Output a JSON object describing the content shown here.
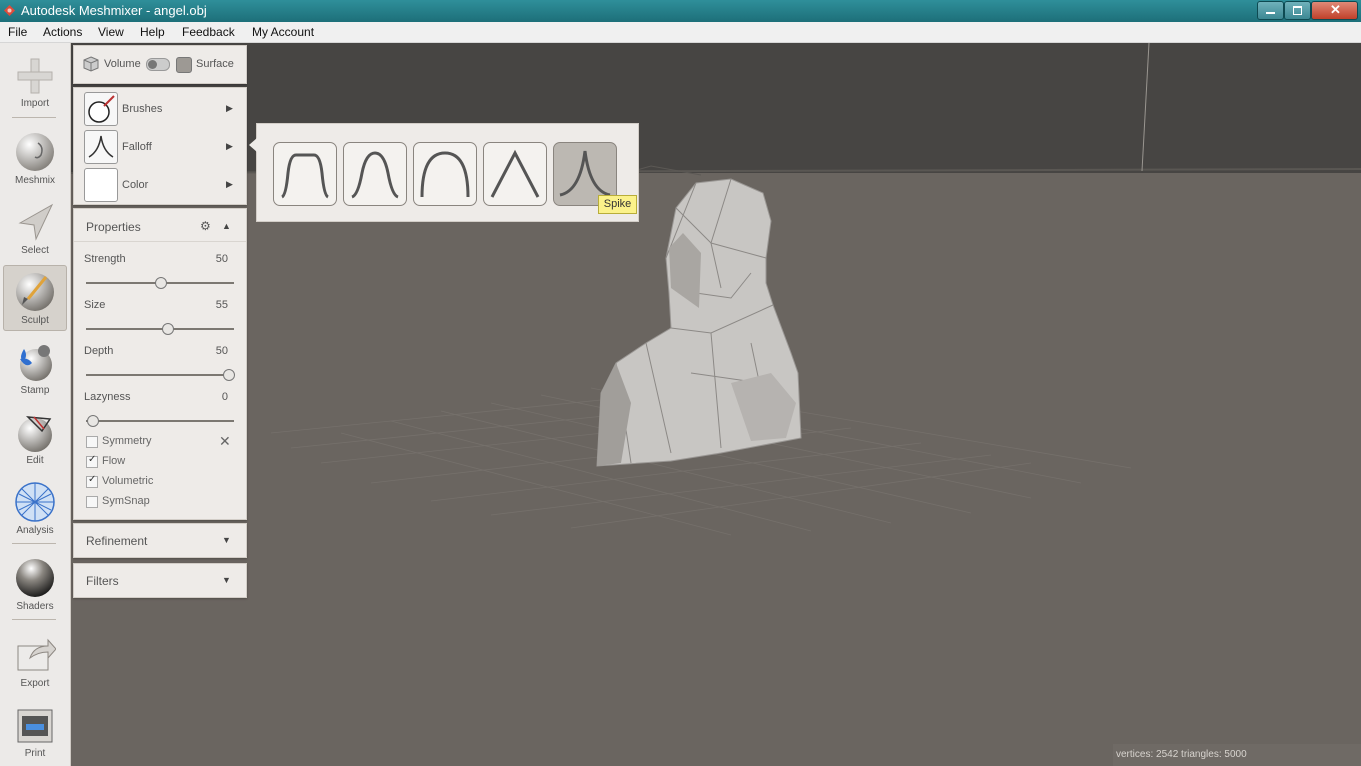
{
  "window": {
    "title": "Autodesk Meshmixer - angel.obj"
  },
  "menu": [
    "File",
    "Actions",
    "View",
    "Help",
    "Feedback",
    "My Account"
  ],
  "toolbar": {
    "tools": [
      {
        "label": "Import",
        "icon": "plus-icon"
      },
      {
        "label": "Meshmix",
        "icon": "meshmix-icon"
      },
      {
        "label": "Select",
        "icon": "select-arrow-icon"
      },
      {
        "label": "Sculpt",
        "icon": "sculpt-brush-icon",
        "active": true
      },
      {
        "label": "Stamp",
        "icon": "stamp-icon"
      },
      {
        "label": "Edit",
        "icon": "edit-icon"
      },
      {
        "label": "Analysis",
        "icon": "analysis-icon"
      },
      {
        "label": "Shaders",
        "icon": "shaders-icon"
      },
      {
        "label": "Export",
        "icon": "export-icon"
      },
      {
        "label": "Print",
        "icon": "print-icon"
      }
    ]
  },
  "mode": {
    "volume_label": "Volume",
    "surface_label": "Surface"
  },
  "brush_panel": {
    "brushes_label": "Brushes",
    "falloff_label": "Falloff",
    "color_label": "Color"
  },
  "properties": {
    "title": "Properties",
    "sliders": [
      {
        "label": "Strength",
        "value": "50",
        "fraction": 0.5
      },
      {
        "label": "Size",
        "value": "55",
        "fraction": 0.55
      },
      {
        "label": "Depth",
        "value": "50",
        "fraction": 1.0
      },
      {
        "label": "Lazyness",
        "value": "0",
        "fraction": 0.0
      }
    ],
    "checkboxes": [
      {
        "label": "Symmetry",
        "checked": false
      },
      {
        "label": "Flow",
        "checked": true
      },
      {
        "label": "Volumetric",
        "checked": true
      },
      {
        "label": "SymSnap",
        "checked": false
      }
    ]
  },
  "refinement": {
    "title": "Refinement"
  },
  "filters": {
    "title": "Filters"
  },
  "falloff_popup": {
    "options": [
      "flat-falloff",
      "smooth-falloff",
      "round-falloff",
      "linear-falloff",
      "spike-falloff"
    ],
    "selected": "spike-falloff",
    "tooltip": "Spike"
  },
  "status": {
    "text": "vertices: 2542 triangles: 5000"
  },
  "colors": {
    "titlebar": "#1d6f79",
    "viewport": "#6a6560",
    "panel": "#eeebe8",
    "tooltip": "#fbf28a"
  }
}
